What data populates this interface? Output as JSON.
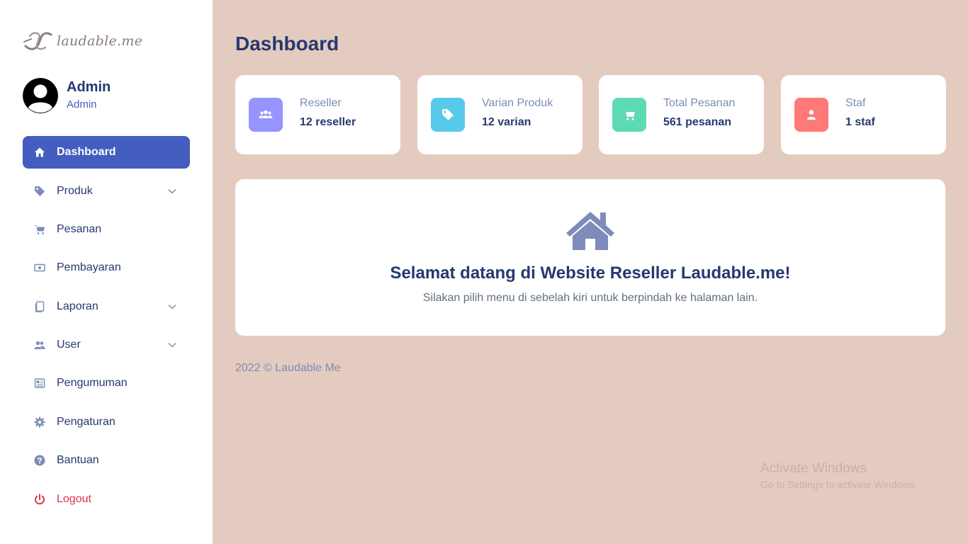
{
  "brand": {
    "logo_text": "laudable.me"
  },
  "profile": {
    "name": "Admin",
    "role": "Admin"
  },
  "sidebar": {
    "items": [
      {
        "label": "Dashboard",
        "icon": "house-icon"
      },
      {
        "label": "Produk",
        "icon": "tag-icon"
      },
      {
        "label": "Pesanan",
        "icon": "cart-icon"
      },
      {
        "label": "Pembayaran",
        "icon": "cash-icon"
      },
      {
        "label": "Laporan",
        "icon": "files-icon"
      },
      {
        "label": "User",
        "icon": "people-icon"
      },
      {
        "label": "Pengumuman",
        "icon": "newspaper-icon"
      },
      {
        "label": "Pengaturan",
        "icon": "gear-icon"
      },
      {
        "label": "Bantuan",
        "icon": "question-circle-icon"
      },
      {
        "label": "Logout",
        "icon": "power-icon"
      }
    ]
  },
  "page": {
    "title": "Dashboard"
  },
  "stats": [
    {
      "label": "Reseller",
      "value": "12 reseller",
      "color": "#9694ff",
      "icon": "people-icon"
    },
    {
      "label": "Varian Produk",
      "value": "12 varian",
      "color": "#57caeb",
      "icon": "tag-icon"
    },
    {
      "label": "Total Pesanan",
      "value": "561 pesanan",
      "color": "#5ddab4",
      "icon": "cart-icon"
    },
    {
      "label": "Staf",
      "value": "1 staf",
      "color": "#ff7976",
      "icon": "person-icon"
    }
  ],
  "welcome": {
    "title": "Selamat datang di Website Reseller Laudable.me!",
    "subtitle": "Silakan pilih menu di sebelah kiri untuk berpindah ke halaman lain."
  },
  "footer": {
    "text": "2022 © Laudable Me"
  },
  "watermark": {
    "title": "Activate Windows",
    "subtitle": "Go to Settings to activate Windows."
  },
  "colors": {
    "primary": "#435ebe",
    "heading": "#25396f",
    "muted": "#7c8db5",
    "background": "#e4cbc0",
    "icon_gray": "#7c8db5",
    "danger": "#dc3545"
  }
}
